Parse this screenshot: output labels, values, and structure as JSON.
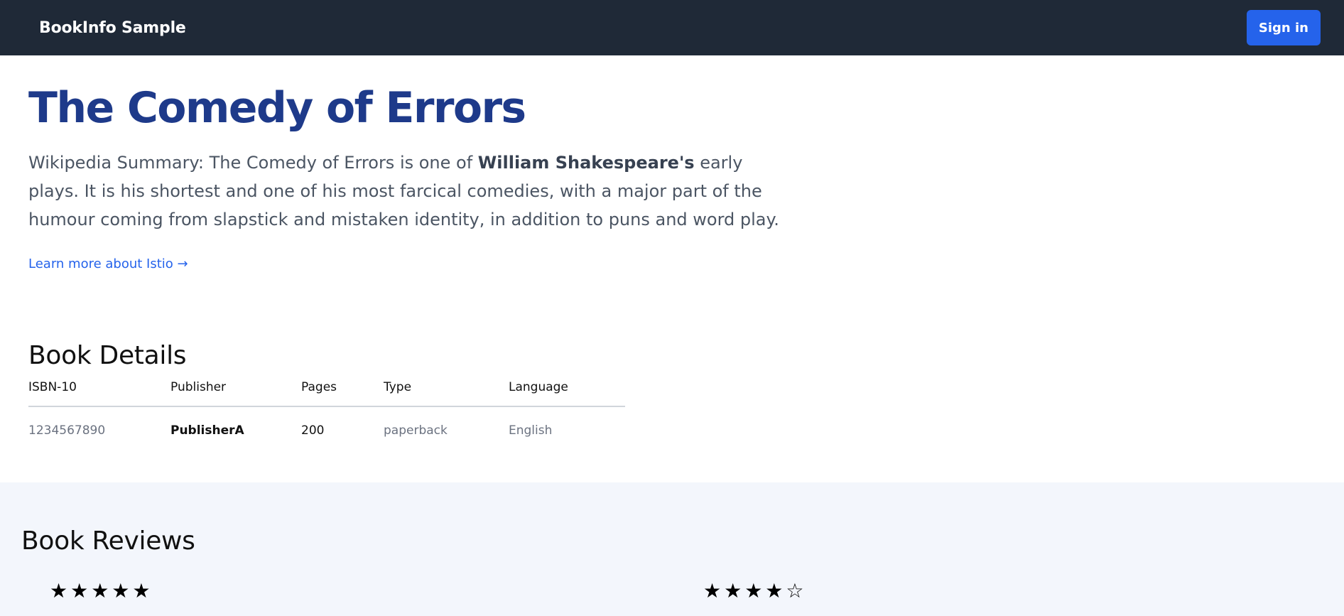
{
  "navbar": {
    "brand": "BookInfo Sample",
    "signin_label": "Sign in"
  },
  "hero": {
    "title": "The Comedy of Errors",
    "summary_prefix": "Wikipedia Summary: The Comedy of Errors is one of ",
    "summary_bold": "William Shakespeare's",
    "summary_suffix": " early plays. It is his shortest and one of his most farcical comedies, with a major part of the humour coming from slapstick and mistaken identity, in addition to puns and word play.",
    "learn_more": "Learn more about Istio →"
  },
  "details": {
    "heading": "Book Details",
    "columns": [
      "ISBN-10",
      "Publisher",
      "Pages",
      "Type",
      "Language"
    ],
    "row": [
      "1234567890",
      "PublisherA",
      "200",
      "paperback",
      "English"
    ]
  },
  "reviews": {
    "heading": "Book Reviews",
    "items": [
      {
        "stars": "★★★★★",
        "rating": 5
      },
      {
        "stars": "★★★★☆",
        "rating": 4
      }
    ]
  }
}
